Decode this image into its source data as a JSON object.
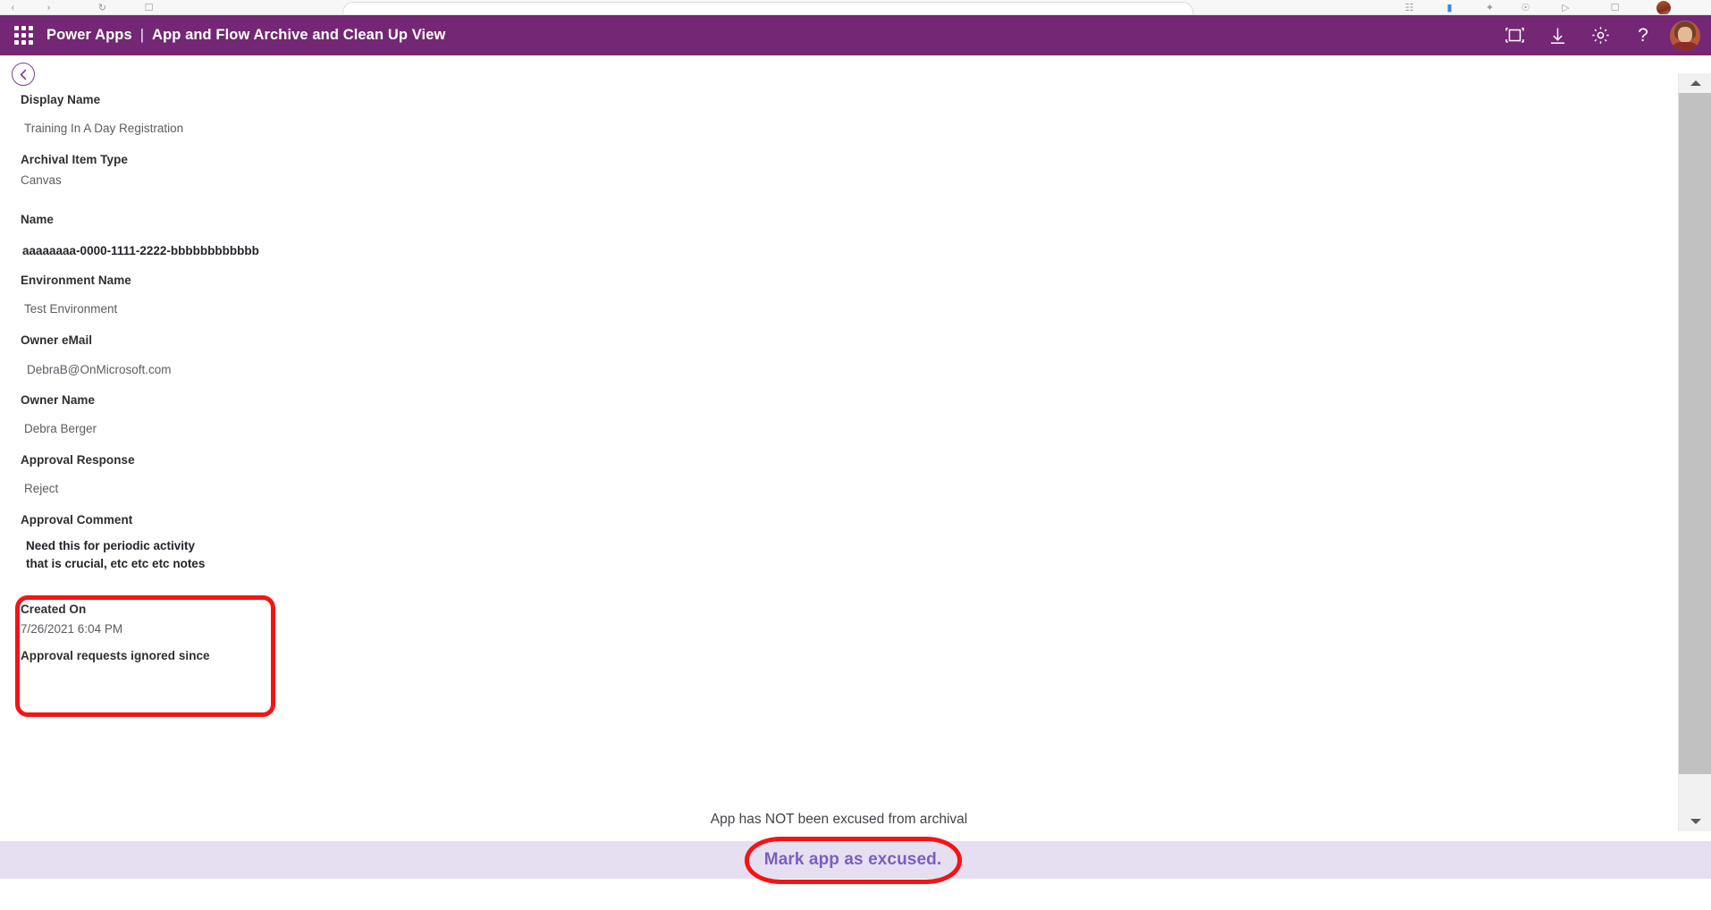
{
  "browser": {
    "address_bar_text": "",
    "icons": [
      "back-arrow-icon",
      "forward-arrow-icon",
      "reload-icon",
      "bookmark-icon",
      "extensions-icon",
      "profile-avatar-icon"
    ]
  },
  "header": {
    "waffle_label": "app-launcher",
    "brand": "Power Apps",
    "separator": "|",
    "subtitle": "App and Flow Archive and Clean Up View",
    "accent_color": "#742774",
    "actions": [
      {
        "name": "fit-to-screen-icon",
        "label": "Fit to screen"
      },
      {
        "name": "download-icon",
        "label": "Download"
      },
      {
        "name": "settings-gear-icon",
        "label": "Settings"
      },
      {
        "name": "help-icon",
        "label": "?"
      }
    ],
    "avatar_label": "account-avatar"
  },
  "content": {
    "back_button_label": "Back",
    "fields": [
      {
        "label": "Display Name",
        "value": "Training In A Day Registration"
      },
      {
        "label": "Archival Item Type",
        "value": "Canvas"
      },
      {
        "label": "Name",
        "value": "aaaaaaaa-0000-1111-2222-bbbbbbbbbbbb"
      },
      {
        "label": "Environment Name",
        "value": "Test Environment"
      },
      {
        "label": "Owner eMail",
        "value": "DebraB@OnMicrosoft.com"
      },
      {
        "label": "Owner Name",
        "value": "Debra Berger"
      },
      {
        "label": "Approval Response",
        "value": "Reject"
      },
      {
        "label": "Approval Comment",
        "value": "Need this for periodic activity that is crucial, etc etc etc notes"
      },
      {
        "label": "Created On",
        "value": "7/26/2021 6:04 PM"
      },
      {
        "label": "Approval requests ignored since",
        "value": ""
      }
    ]
  },
  "footer": {
    "status_text": "App has NOT been excused from archival",
    "cta_label": "Mark app as excused.",
    "bar_color": "#e6dff2",
    "cta_text_color": "#7a5fbf"
  },
  "annotations": {
    "color": "#f41414",
    "items": [
      {
        "name": "approval-comment-highlight",
        "shape": "rounded-rect"
      },
      {
        "name": "mark-app-as-excused-highlight",
        "shape": "ellipse"
      }
    ]
  },
  "scrollbar": {
    "up_label": "scroll-up",
    "down_label": "scroll-down",
    "thumb_label": "scroll-thumb"
  }
}
